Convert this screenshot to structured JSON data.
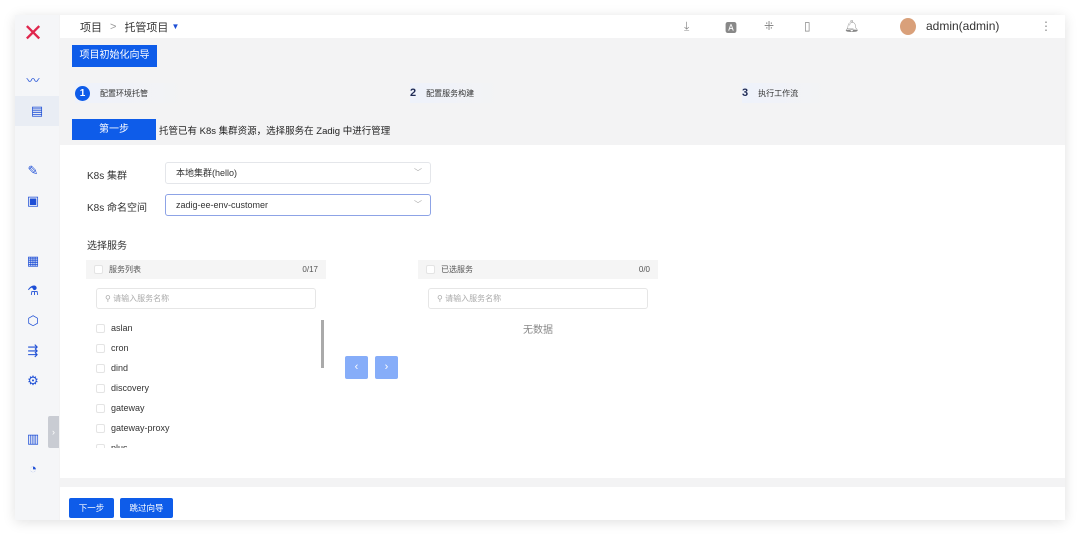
{
  "header": {
    "breadcrumb": [
      "项目",
      "托管项目"
    ],
    "separator": ">",
    "user": "admin(admin)"
  },
  "guide": {
    "title": "项目初始化向导",
    "steps": [
      {
        "num": "1",
        "label": "配置环境托管"
      },
      {
        "num": "2",
        "label": "配置服务构建"
      },
      {
        "num": "3",
        "label": "执行工作流"
      }
    ],
    "current_step_label": "第一步",
    "description": "托管已有 K8s 集群资源，选择服务在 Zadig 中进行管理"
  },
  "form": {
    "cluster_label": "K8s 集群",
    "cluster_value": "本地集群(hello)",
    "namespace_label": "K8s 命名空间",
    "namespace_value": "zadig-ee-env-customer",
    "select_services_label": "选择服务"
  },
  "transfer": {
    "left": {
      "title": "服务列表",
      "count": "0/17",
      "placeholder": "请输入服务名称",
      "items": [
        "aslan",
        "cron",
        "dind",
        "discovery",
        "gateway",
        "gateway-proxy",
        "plus"
      ]
    },
    "right": {
      "title": "已选服务",
      "count": "0/0",
      "placeholder": "请输入服务名称",
      "empty": "无数据"
    }
  },
  "footer": {
    "next": "下一步",
    "skip": "跳过向导"
  },
  "colors": {
    "primary": "#0e5ce9",
    "logo": "#e0264d"
  }
}
